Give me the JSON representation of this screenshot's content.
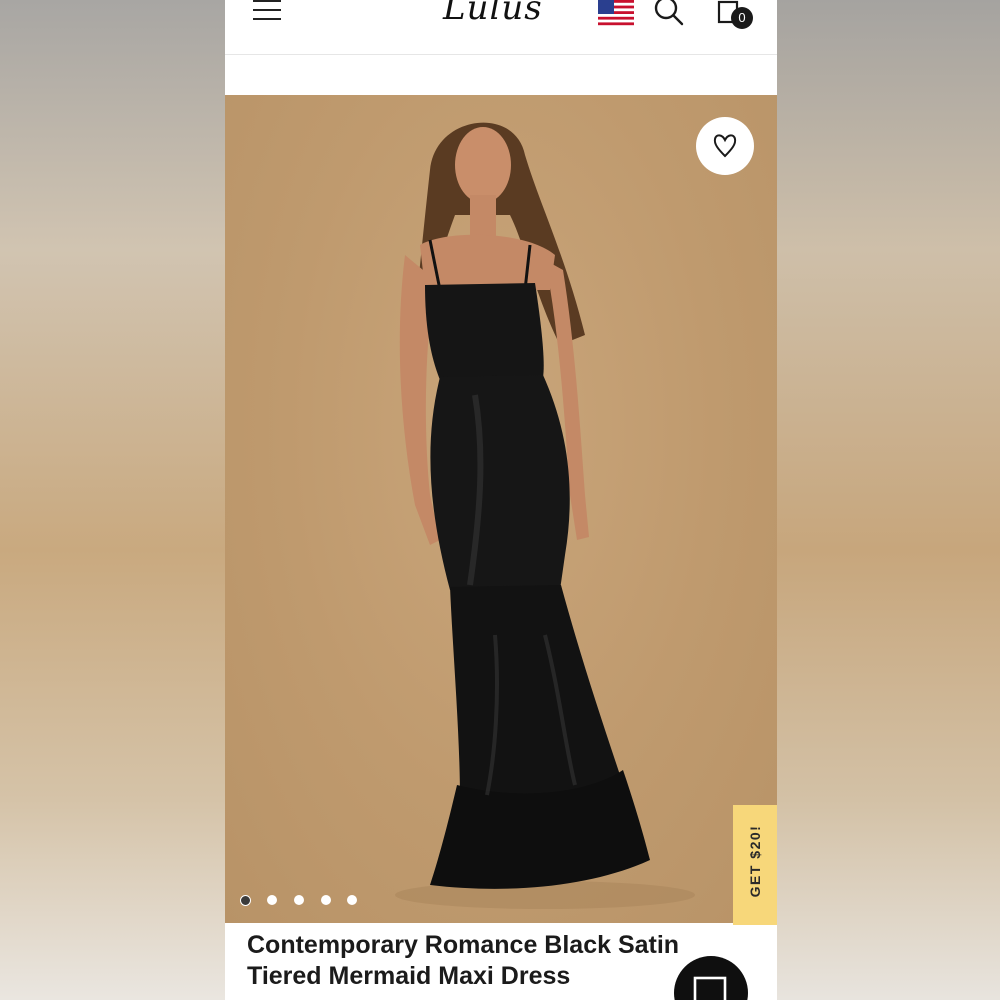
{
  "header": {
    "logo_text": "Lulus",
    "cart_count": "0",
    "promo_text": "",
    "icons": [
      "menu-icon",
      "us-flag-icon",
      "search-icon",
      "shopping-bag-icon"
    ]
  },
  "hero": {
    "background_color": "#c4a074",
    "dress_color": "#121212",
    "carousel": {
      "total": 5,
      "active_index": 0
    }
  },
  "promo_tab": {
    "label": "GET $20!",
    "color": "#f7d77a"
  },
  "product": {
    "title_line1": "Contemporary Romance Black Satin",
    "title_line2": "Tiered Mermaid Maxi Dress"
  },
  "chat": {
    "icon": "chat-icon"
  }
}
